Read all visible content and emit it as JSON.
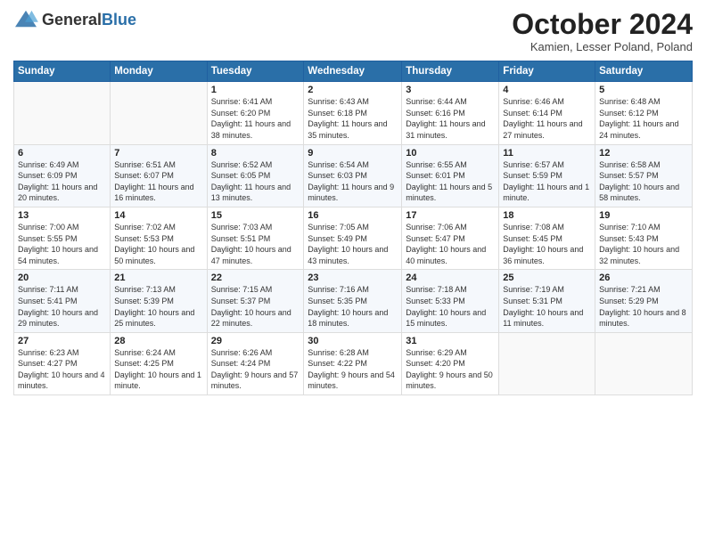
{
  "header": {
    "logo_general": "General",
    "logo_blue": "Blue",
    "month_title": "October 2024",
    "subtitle": "Kamien, Lesser Poland, Poland"
  },
  "weekdays": [
    "Sunday",
    "Monday",
    "Tuesday",
    "Wednesday",
    "Thursday",
    "Friday",
    "Saturday"
  ],
  "weeks": [
    [
      {
        "day": "",
        "sunrise": "",
        "sunset": "",
        "daylight": ""
      },
      {
        "day": "",
        "sunrise": "",
        "sunset": "",
        "daylight": ""
      },
      {
        "day": "1",
        "sunrise": "Sunrise: 6:41 AM",
        "sunset": "Sunset: 6:20 PM",
        "daylight": "Daylight: 11 hours and 38 minutes."
      },
      {
        "day": "2",
        "sunrise": "Sunrise: 6:43 AM",
        "sunset": "Sunset: 6:18 PM",
        "daylight": "Daylight: 11 hours and 35 minutes."
      },
      {
        "day": "3",
        "sunrise": "Sunrise: 6:44 AM",
        "sunset": "Sunset: 6:16 PM",
        "daylight": "Daylight: 11 hours and 31 minutes."
      },
      {
        "day": "4",
        "sunrise": "Sunrise: 6:46 AM",
        "sunset": "Sunset: 6:14 PM",
        "daylight": "Daylight: 11 hours and 27 minutes."
      },
      {
        "day": "5",
        "sunrise": "Sunrise: 6:48 AM",
        "sunset": "Sunset: 6:12 PM",
        "daylight": "Daylight: 11 hours and 24 minutes."
      }
    ],
    [
      {
        "day": "6",
        "sunrise": "Sunrise: 6:49 AM",
        "sunset": "Sunset: 6:09 PM",
        "daylight": "Daylight: 11 hours and 20 minutes."
      },
      {
        "day": "7",
        "sunrise": "Sunrise: 6:51 AM",
        "sunset": "Sunset: 6:07 PM",
        "daylight": "Daylight: 11 hours and 16 minutes."
      },
      {
        "day": "8",
        "sunrise": "Sunrise: 6:52 AM",
        "sunset": "Sunset: 6:05 PM",
        "daylight": "Daylight: 11 hours and 13 minutes."
      },
      {
        "day": "9",
        "sunrise": "Sunrise: 6:54 AM",
        "sunset": "Sunset: 6:03 PM",
        "daylight": "Daylight: 11 hours and 9 minutes."
      },
      {
        "day": "10",
        "sunrise": "Sunrise: 6:55 AM",
        "sunset": "Sunset: 6:01 PM",
        "daylight": "Daylight: 11 hours and 5 minutes."
      },
      {
        "day": "11",
        "sunrise": "Sunrise: 6:57 AM",
        "sunset": "Sunset: 5:59 PM",
        "daylight": "Daylight: 11 hours and 1 minute."
      },
      {
        "day": "12",
        "sunrise": "Sunrise: 6:58 AM",
        "sunset": "Sunset: 5:57 PM",
        "daylight": "Daylight: 10 hours and 58 minutes."
      }
    ],
    [
      {
        "day": "13",
        "sunrise": "Sunrise: 7:00 AM",
        "sunset": "Sunset: 5:55 PM",
        "daylight": "Daylight: 10 hours and 54 minutes."
      },
      {
        "day": "14",
        "sunrise": "Sunrise: 7:02 AM",
        "sunset": "Sunset: 5:53 PM",
        "daylight": "Daylight: 10 hours and 50 minutes."
      },
      {
        "day": "15",
        "sunrise": "Sunrise: 7:03 AM",
        "sunset": "Sunset: 5:51 PM",
        "daylight": "Daylight: 10 hours and 47 minutes."
      },
      {
        "day": "16",
        "sunrise": "Sunrise: 7:05 AM",
        "sunset": "Sunset: 5:49 PM",
        "daylight": "Daylight: 10 hours and 43 minutes."
      },
      {
        "day": "17",
        "sunrise": "Sunrise: 7:06 AM",
        "sunset": "Sunset: 5:47 PM",
        "daylight": "Daylight: 10 hours and 40 minutes."
      },
      {
        "day": "18",
        "sunrise": "Sunrise: 7:08 AM",
        "sunset": "Sunset: 5:45 PM",
        "daylight": "Daylight: 10 hours and 36 minutes."
      },
      {
        "day": "19",
        "sunrise": "Sunrise: 7:10 AM",
        "sunset": "Sunset: 5:43 PM",
        "daylight": "Daylight: 10 hours and 32 minutes."
      }
    ],
    [
      {
        "day": "20",
        "sunrise": "Sunrise: 7:11 AM",
        "sunset": "Sunset: 5:41 PM",
        "daylight": "Daylight: 10 hours and 29 minutes."
      },
      {
        "day": "21",
        "sunrise": "Sunrise: 7:13 AM",
        "sunset": "Sunset: 5:39 PM",
        "daylight": "Daylight: 10 hours and 25 minutes."
      },
      {
        "day": "22",
        "sunrise": "Sunrise: 7:15 AM",
        "sunset": "Sunset: 5:37 PM",
        "daylight": "Daylight: 10 hours and 22 minutes."
      },
      {
        "day": "23",
        "sunrise": "Sunrise: 7:16 AM",
        "sunset": "Sunset: 5:35 PM",
        "daylight": "Daylight: 10 hours and 18 minutes."
      },
      {
        "day": "24",
        "sunrise": "Sunrise: 7:18 AM",
        "sunset": "Sunset: 5:33 PM",
        "daylight": "Daylight: 10 hours and 15 minutes."
      },
      {
        "day": "25",
        "sunrise": "Sunrise: 7:19 AM",
        "sunset": "Sunset: 5:31 PM",
        "daylight": "Daylight: 10 hours and 11 minutes."
      },
      {
        "day": "26",
        "sunrise": "Sunrise: 7:21 AM",
        "sunset": "Sunset: 5:29 PM",
        "daylight": "Daylight: 10 hours and 8 minutes."
      }
    ],
    [
      {
        "day": "27",
        "sunrise": "Sunrise: 6:23 AM",
        "sunset": "Sunset: 4:27 PM",
        "daylight": "Daylight: 10 hours and 4 minutes."
      },
      {
        "day": "28",
        "sunrise": "Sunrise: 6:24 AM",
        "sunset": "Sunset: 4:25 PM",
        "daylight": "Daylight: 10 hours and 1 minute."
      },
      {
        "day": "29",
        "sunrise": "Sunrise: 6:26 AM",
        "sunset": "Sunset: 4:24 PM",
        "daylight": "Daylight: 9 hours and 57 minutes."
      },
      {
        "day": "30",
        "sunrise": "Sunrise: 6:28 AM",
        "sunset": "Sunset: 4:22 PM",
        "daylight": "Daylight: 9 hours and 54 minutes."
      },
      {
        "day": "31",
        "sunrise": "Sunrise: 6:29 AM",
        "sunset": "Sunset: 4:20 PM",
        "daylight": "Daylight: 9 hours and 50 minutes."
      },
      {
        "day": "",
        "sunrise": "",
        "sunset": "",
        "daylight": ""
      },
      {
        "day": "",
        "sunrise": "",
        "sunset": "",
        "daylight": ""
      }
    ]
  ]
}
